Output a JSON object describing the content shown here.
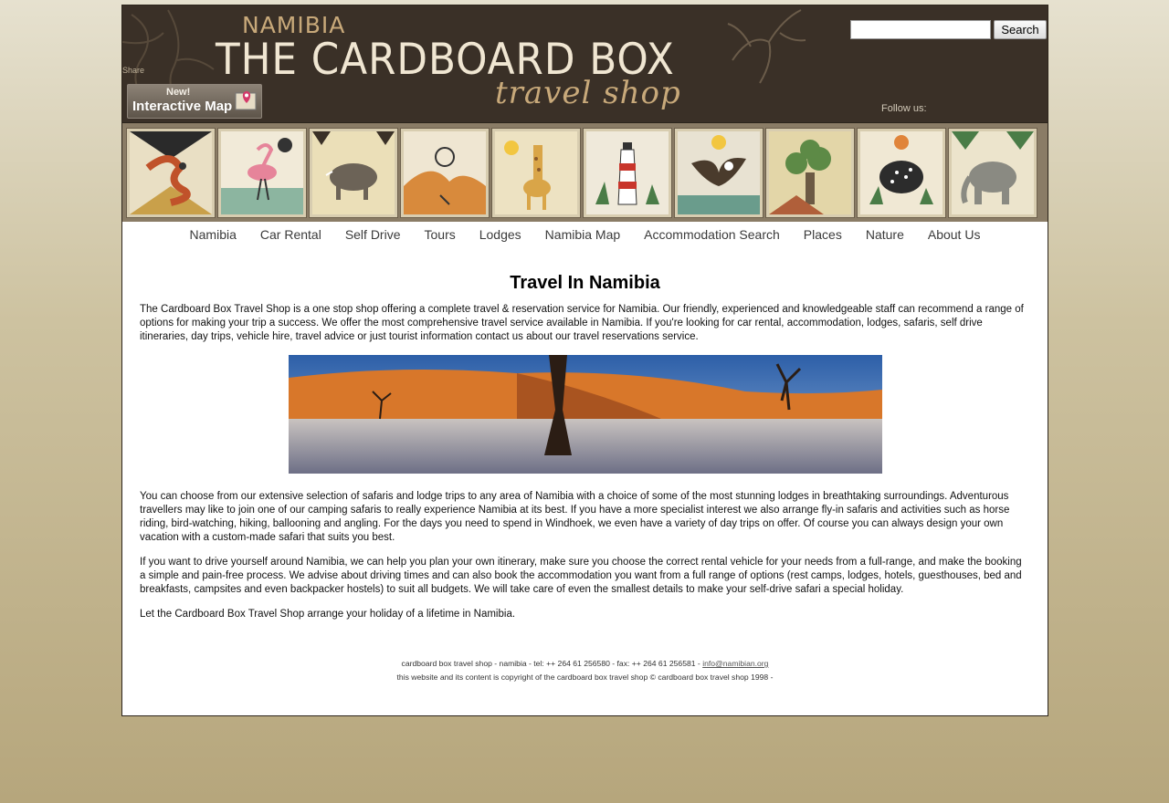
{
  "header": {
    "logo_top": "NAMIBIA",
    "logo_main": "THE CARDBOARD BOX",
    "logo_sub": "travel shop",
    "share_label": "Share",
    "interactive_map": {
      "badge": "New!",
      "label": "Interactive Map"
    },
    "search": {
      "value": "",
      "placeholder": "",
      "button_label": "Search"
    },
    "follow_label": "Follow us:"
  },
  "tiles": [
    {
      "name": "snake-tile",
      "icon": "snake-icon"
    },
    {
      "name": "flamingo-tile",
      "icon": "flamingo-icon"
    },
    {
      "name": "warthog-tile",
      "icon": "warthog-icon"
    },
    {
      "name": "dunes-tile",
      "icon": "dunes-icon"
    },
    {
      "name": "giraffe-tile",
      "icon": "giraffe-icon"
    },
    {
      "name": "lighthouse-tile",
      "icon": "lighthouse-icon"
    },
    {
      "name": "eagle-tile",
      "icon": "eagle-icon"
    },
    {
      "name": "tree-tile",
      "icon": "tree-icon"
    },
    {
      "name": "guineafowl-tile",
      "icon": "guineafowl-icon"
    },
    {
      "name": "elephant-tile",
      "icon": "elephant-icon"
    }
  ],
  "nav": [
    "Namibia",
    "Car Rental",
    "Self Drive",
    "Tours",
    "Lodges",
    "Namibia Map",
    "Accommodation Search",
    "Places",
    "Nature",
    "About Us"
  ],
  "main": {
    "title": "Travel In Namibia",
    "paragraphs": [
      "The Cardboard Box Travel Shop is a one stop shop offering a complete travel & reservation service for Namibia. Our friendly, experienced and knowledgeable staff can recommend a range of options for making your trip a success. We offer the most comprehensive travel service available in Namibia. If you're looking for car rental, accommodation, lodges, safaris, self drive itineraries, day trips, vehicle hire, travel advice or just tourist information contact us about our travel reservations service.",
      "You can choose from our extensive selection of safaris and lodge trips to any area of Namibia with a choice of some of the most stunning lodges in breathtaking surroundings. Adventurous travellers may like to join one of our camping safaris to really experience Namibia at its best. If you have a more specialist interest we also arrange fly-in safaris and activities such as horse riding, bird-watching, hiking, ballooning and angling. For the days you need to spend in Windhoek, we even have a variety of day trips on offer. Of course you can always design your own vacation with a custom-made safari that suits you best.",
      "If you want to drive yourself around Namibia, we can help you plan your own itinerary, make sure you choose the correct rental vehicle for your needs from a full-range, and make the booking a simple and pain-free process. We advise about driving times and can also book the accommodation you want from a full range of options (rest camps, lodges, hotels, guesthouses, bed and breakfasts, campsites and even backpacker hostels) to suit all budgets. We will take care of even the smallest details to make your self-drive safari a special holiday.",
      "Let the Cardboard Box Travel Shop arrange your holiday of a lifetime in Namibia."
    ]
  },
  "footer": {
    "line1_prefix": "cardboard box travel shop - namibia - tel: ++ 264 61 256580 - fax: ++ 264 61 256581 - ",
    "email": "info@namibian.org",
    "line2": "this website and its content is copyright of the cardboard box travel shop © cardboard box travel shop 1998 -"
  },
  "colors": {
    "header_bg": "#3a3027",
    "tile_strip": "#8a7c66",
    "logo_accent": "#c8a97a"
  }
}
